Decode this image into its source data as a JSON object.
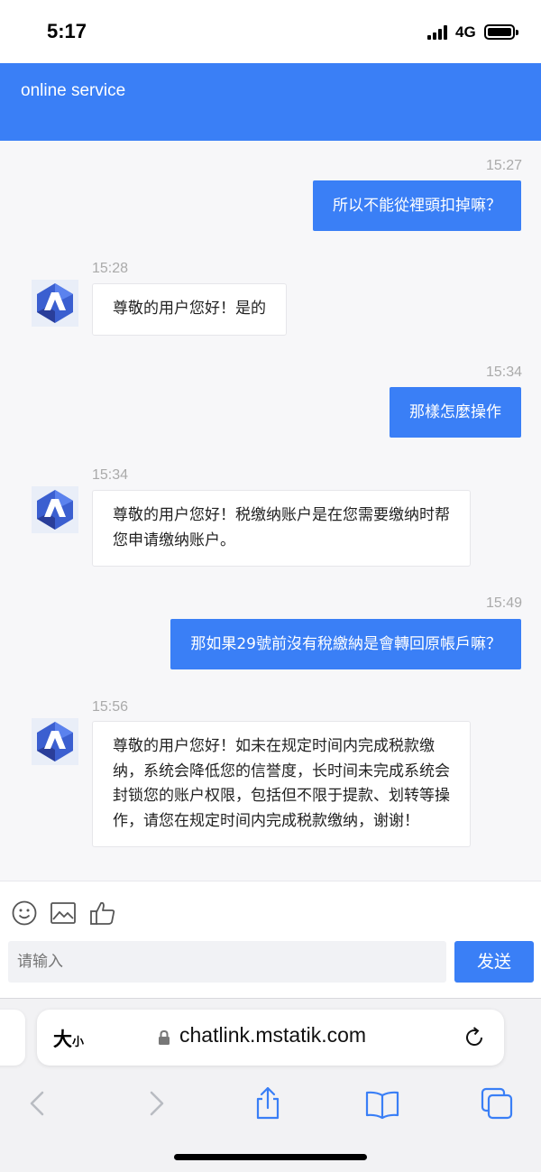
{
  "status_bar": {
    "time": "5:17",
    "network": "4G"
  },
  "header": {
    "title": "online service"
  },
  "messages": [
    {
      "side": "out",
      "time": "15:27",
      "text": "所以不能從裡頭扣掉嘛？"
    },
    {
      "side": "in",
      "time": "15:28",
      "text": "尊敬的用户您好！是的"
    },
    {
      "side": "out",
      "time": "15:34",
      "text": "那樣怎麼操作"
    },
    {
      "side": "in",
      "time": "15:34",
      "lines": [
        "尊敬的用户您好！税缴纳账户是在您需要缴纳时帮",
        "您申请缴纳账户。"
      ]
    },
    {
      "side": "out",
      "time": "15:49",
      "text": "那如果29號前沒有稅繳納是會轉回原帳戶嘛？"
    },
    {
      "side": "in",
      "time": "15:56",
      "lines": [
        "尊敬的用户您好！如未在规定时间内完成税款缴",
        "纳，系统会降低您的信誉度，长时间未完成系统会",
        "封锁您的账户权限，包括但不限于提款、划转等操",
        "作，请您在规定时间内完成税款缴纳，谢谢！"
      ]
    }
  ],
  "composer": {
    "tools": [
      "emoji-icon",
      "image-icon",
      "thumbs-up-icon"
    ],
    "placeholder": "请输入",
    "send_label": "发送"
  },
  "browser": {
    "text_size_label": "大",
    "text_size_small": "小",
    "url": "chatlink.mstatik.com"
  },
  "colors": {
    "accent": "#3a7ff6",
    "chat_bg": "#f7f7f9",
    "timestamp": "#aaaaaa"
  }
}
